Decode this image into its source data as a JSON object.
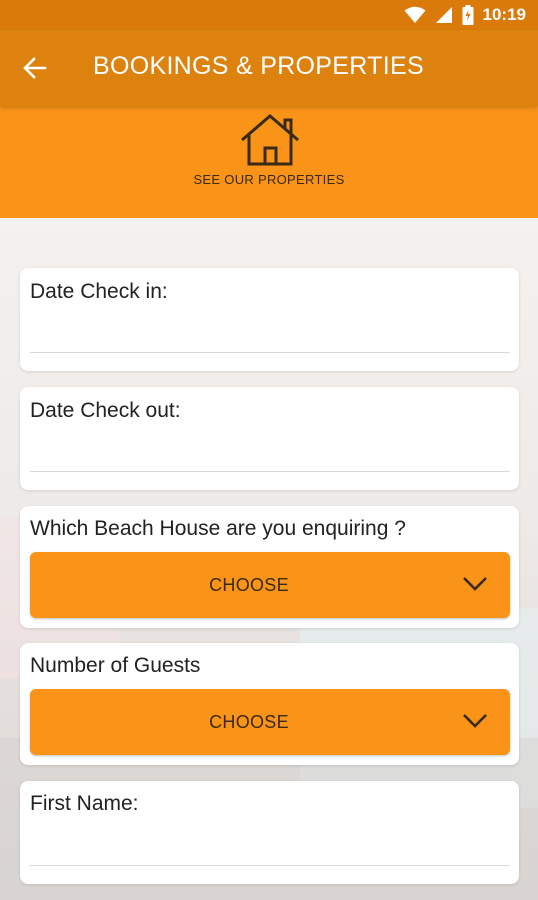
{
  "status_bar": {
    "time": "10:19",
    "icons": [
      "wifi-icon",
      "signal-icon",
      "battery-icon"
    ]
  },
  "toolbar": {
    "back_icon": "back-arrow-icon",
    "title": "BOOKINGS & PROPERTIES"
  },
  "banner": {
    "icon": "house-icon",
    "label": "SEE OUR PROPERTIES"
  },
  "form": {
    "check_in_label": "Date Check in:",
    "check_out_label": "Date Check out:",
    "beach_house_label": "Which Beach House are you enquiring ?",
    "beach_house_select": "CHOOSE",
    "guests_label": "Number of Guests",
    "guests_select": "CHOOSE",
    "first_name_label": "First Name:"
  },
  "colors": {
    "status_bar": "#d97a0b",
    "toolbar": "#dd820f",
    "accent": "#f99419"
  }
}
